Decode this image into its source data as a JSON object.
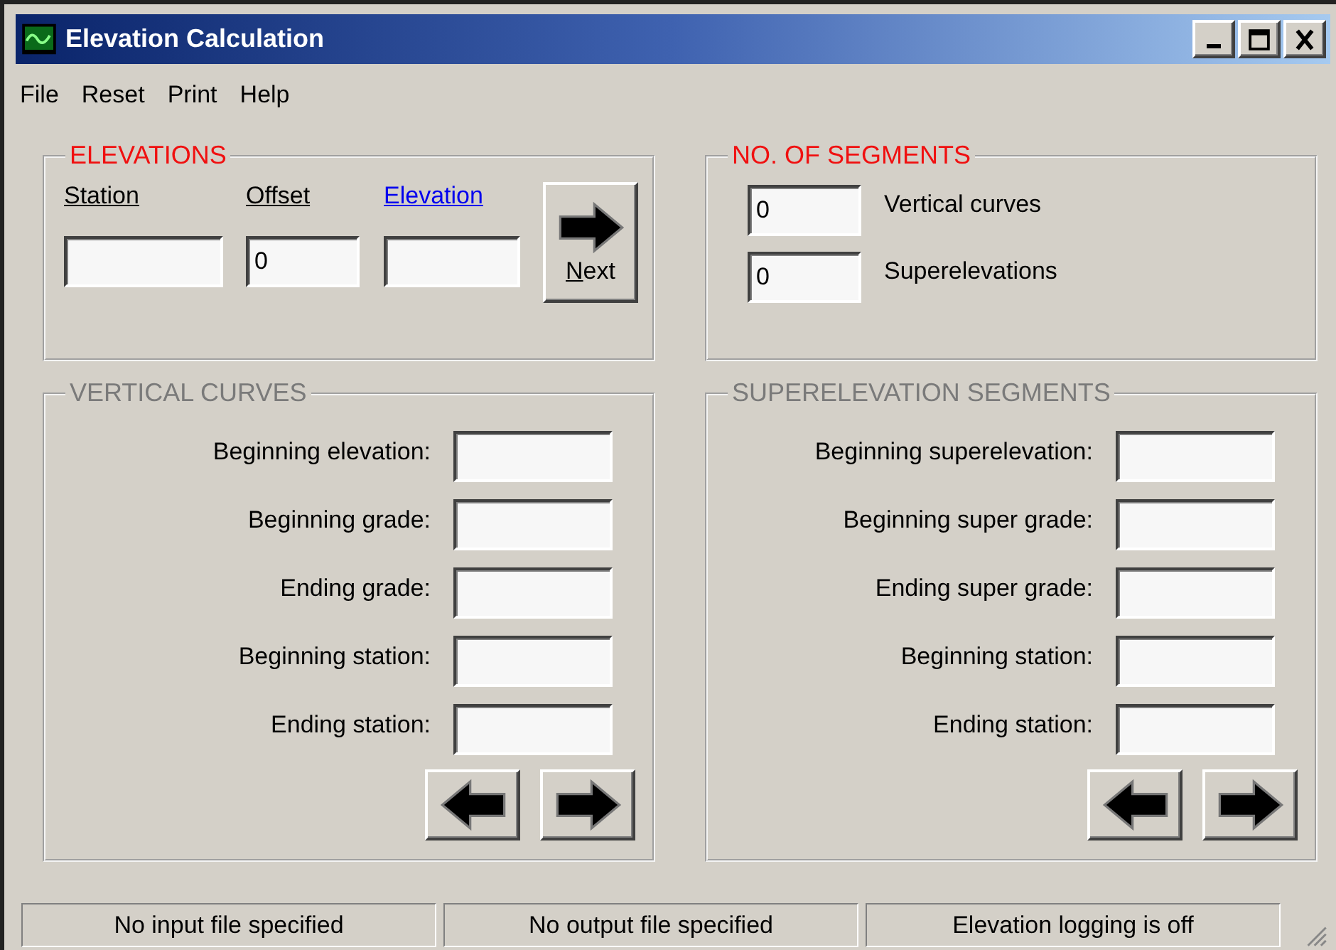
{
  "window": {
    "title": "Elevation Calculation"
  },
  "menu": [
    "File",
    "Reset",
    "Print",
    "Help"
  ],
  "elevations": {
    "title": "ELEVATIONS",
    "disabled": false,
    "columns": [
      {
        "label": "Station",
        "selected": false
      },
      {
        "label": "Offset",
        "selected": false,
        "value": "0"
      },
      {
        "label": "Elevation",
        "selected": true
      }
    ],
    "next_button": "Next"
  },
  "segments": {
    "title": "NO. OF SEGMENTS",
    "disabled": false,
    "rows": [
      {
        "value": "0",
        "label": "Vertical curves"
      },
      {
        "value": "0",
        "label": "Superelevations"
      }
    ]
  },
  "vertical_curves": {
    "title": "VERTICAL CURVES",
    "disabled": true,
    "rows": [
      {
        "label": "Beginning elevation:"
      },
      {
        "label": "Beginning grade:"
      },
      {
        "label": "Ending grade:"
      },
      {
        "label": "Beginning station:"
      },
      {
        "label": "Ending station:"
      }
    ]
  },
  "superelevation_segments": {
    "title": "SUPERELEVATION SEGMENTS",
    "disabled": true,
    "rows": [
      {
        "label": "Beginning superelevation:"
      },
      {
        "label": "Beginning super grade:"
      },
      {
        "label": "Ending super grade:"
      },
      {
        "label": "Beginning station:"
      },
      {
        "label": "Ending station:"
      }
    ]
  },
  "status_bar": [
    "No input file specified",
    "No output file specified",
    "Elevation logging is off"
  ]
}
